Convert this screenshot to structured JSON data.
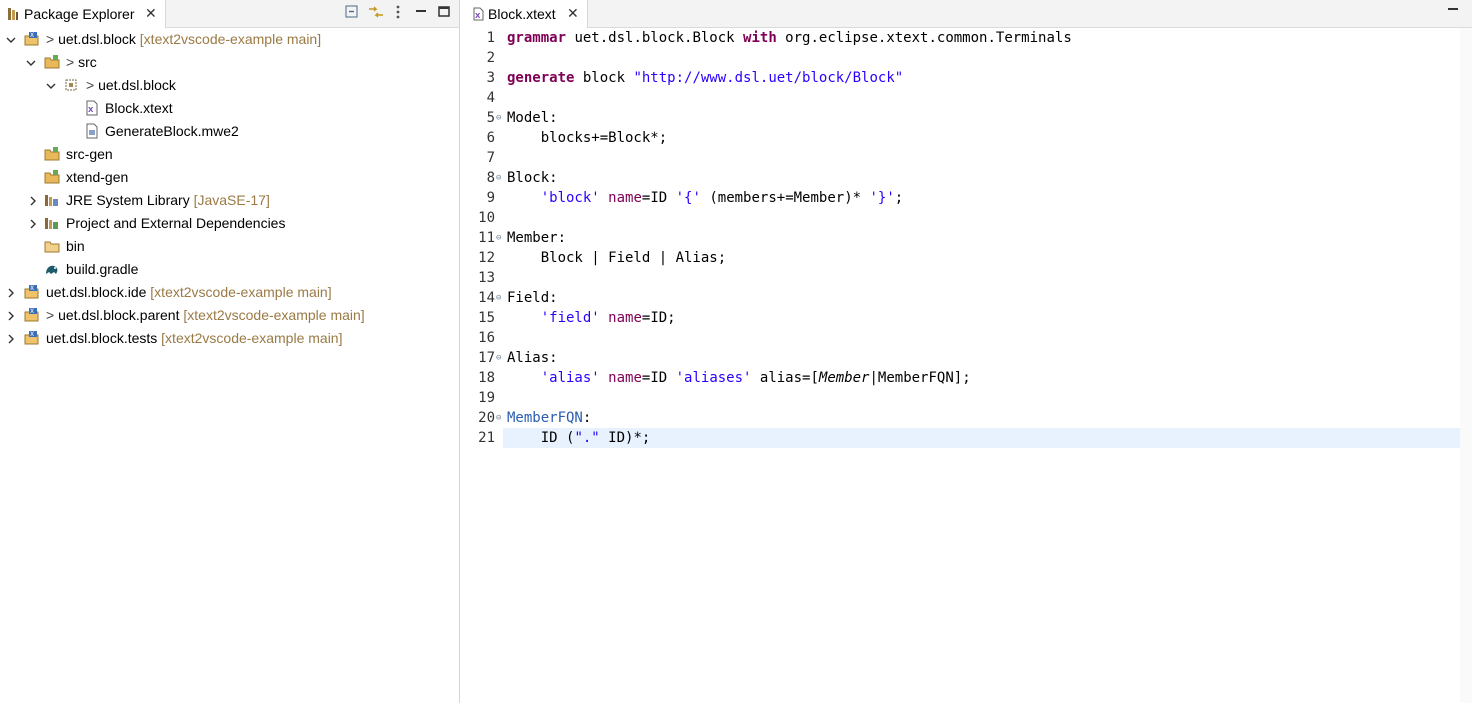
{
  "explorer": {
    "title": "Package Explorer",
    "close": "✕",
    "toolbar": [
      "collapse-all-icon",
      "link-with-editor-icon",
      "view-menu-icon",
      "minimize-icon",
      "maximize-icon"
    ],
    "tree": [
      {
        "prefix": "> ",
        "label": "uet.dsl.block",
        "decor": " [xtext2vscode-example main]"
      },
      {
        "prefix": "> ",
        "label": "src",
        "decor": ""
      },
      {
        "prefix": "> ",
        "label": "uet.dsl.block",
        "decor": ""
      },
      {
        "prefix": "",
        "label": "Block.xtext",
        "decor": ""
      },
      {
        "prefix": "",
        "label": "GenerateBlock.mwe2",
        "decor": ""
      },
      {
        "prefix": "",
        "label": "src-gen",
        "decor": ""
      },
      {
        "prefix": "",
        "label": "xtend-gen",
        "decor": ""
      },
      {
        "prefix": "",
        "label": "JRE System Library",
        "decor": " [JavaSE-17]"
      },
      {
        "prefix": "",
        "label": "Project and External Dependencies",
        "decor": ""
      },
      {
        "prefix": "",
        "label": "bin",
        "decor": ""
      },
      {
        "prefix": "",
        "label": "build.gradle",
        "decor": ""
      },
      {
        "prefix": "",
        "label": "uet.dsl.block.ide",
        "decor": " [xtext2vscode-example main]"
      },
      {
        "prefix": "> ",
        "label": "uet.dsl.block.parent",
        "decor": " [xtext2vscode-example main]"
      },
      {
        "prefix": "",
        "label": "uet.dsl.block.tests",
        "decor": " [xtext2vscode-example main]"
      }
    ]
  },
  "editor": {
    "tab": "Block.xtext",
    "close": "✕",
    "line_numbers": [
      "1",
      "2",
      "3",
      "4",
      "5",
      "6",
      "7",
      "8",
      "9",
      "10",
      "11",
      "12",
      "13",
      "14",
      "15",
      "16",
      "17",
      "18",
      "19",
      "20",
      "21"
    ],
    "fold_marker": "⊖",
    "code": {
      "l1_kw": "grammar",
      "l1_rest": " uet.dsl.block.Block ",
      "l1_kw2": "with",
      "l1_rest2": " org.eclipse.xtext.common.Terminals",
      "l3_kw": "generate",
      "l3_rest": " block ",
      "l3_str": "\"http://www.dsl.uet/block/Block\"",
      "l5": "Model:",
      "l6": "    blocks+=Block*;",
      "l8": "Block:",
      "l9_a": "    ",
      "l9_b": "'block'",
      "l9_c": " ",
      "l9_d": "name",
      "l9_e": "=ID ",
      "l9_f": "'{'",
      "l9_g": " (members+=Member)* ",
      "l9_h": "'}'",
      "l9_i": ";",
      "l11": "Member:",
      "l12": "    Block | Field | Alias;",
      "l14": "Field:",
      "l15_a": "    ",
      "l15_b": "'field'",
      "l15_c": " ",
      "l15_d": "name",
      "l15_e": "=ID;",
      "l17": "Alias:",
      "l18_a": "    ",
      "l18_b": "'alias'",
      "l18_c": " ",
      "l18_d": "name",
      "l18_e": "=ID ",
      "l18_f": "'aliases'",
      "l18_g": " alias=[",
      "l18_h": "Member",
      "l18_i": "|MemberFQN];",
      "l20": "MemberFQN",
      "l20_colon": ":",
      "l21_a": "    ID (",
      "l21_b": "\".\"",
      "l21_c": " ID)*;"
    }
  }
}
